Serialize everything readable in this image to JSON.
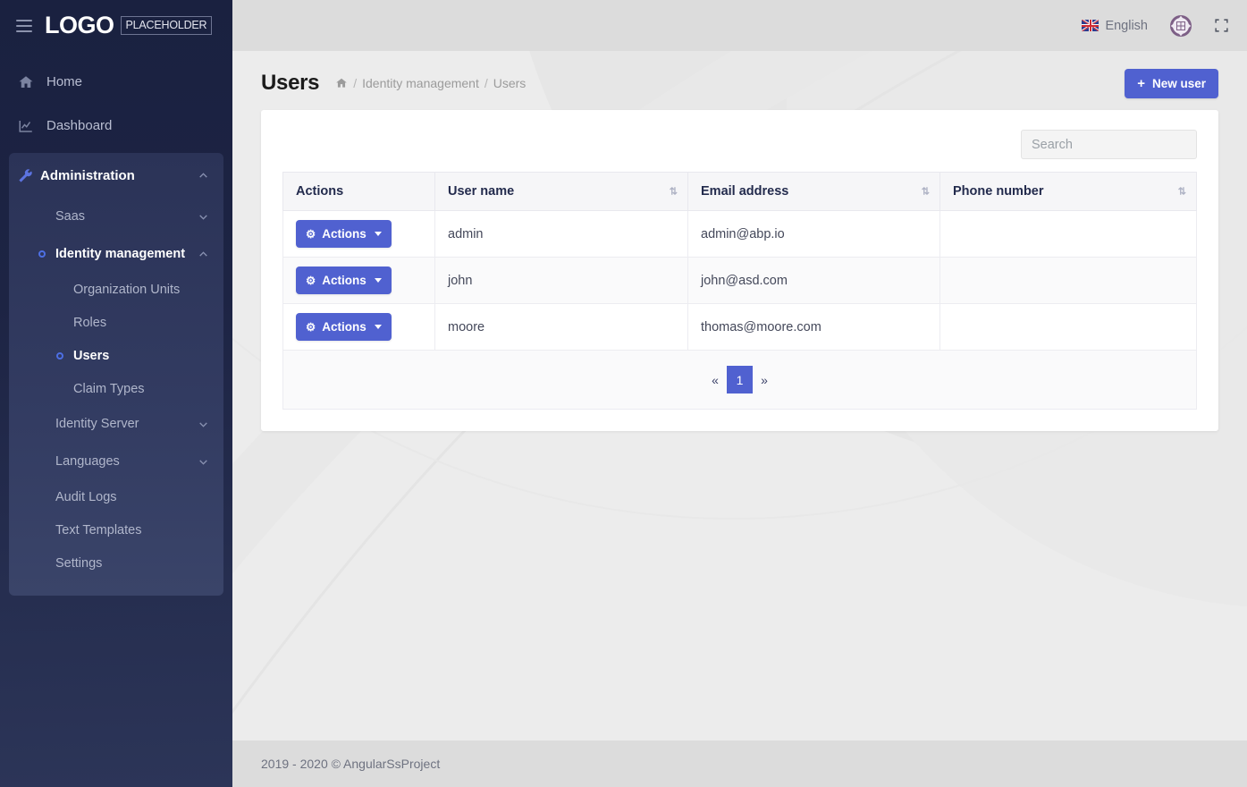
{
  "brand": {
    "menu_icon": "hamburger-icon",
    "logo_text": "LOGO",
    "logo_badge": "PLACEHOLDER"
  },
  "sidebar": {
    "items": [
      {
        "label": "Home",
        "icon": "home-icon"
      },
      {
        "label": "Dashboard",
        "icon": "chart-line-icon"
      }
    ],
    "administration": {
      "label": "Administration",
      "icon": "wrench-icon",
      "expanded": true,
      "chevron": "chevron-up-icon",
      "children": [
        {
          "label": "Saas",
          "type": "group",
          "expanded": false,
          "chevron": "chevron-down-icon"
        },
        {
          "label": "Identity management",
          "type": "group",
          "expanded": true,
          "active": true,
          "chevron": "chevron-up-icon"
        },
        {
          "label": "Organization Units",
          "type": "leaf"
        },
        {
          "label": "Roles",
          "type": "leaf"
        },
        {
          "label": "Users",
          "type": "leaf",
          "active": true
        },
        {
          "label": "Claim Types",
          "type": "leaf"
        },
        {
          "label": "Identity Server",
          "type": "group",
          "expanded": false,
          "chevron": "chevron-down-icon"
        },
        {
          "label": "Languages",
          "type": "group",
          "expanded": false,
          "chevron": "chevron-down-icon"
        },
        {
          "label": "Audit Logs",
          "type": "plain"
        },
        {
          "label": "Text Templates",
          "type": "plain"
        },
        {
          "label": "Settings",
          "type": "plain"
        }
      ]
    }
  },
  "topbar": {
    "language": "English",
    "language_flag": "uk-flag-icon",
    "avatar_icon": "user-avatar-icon",
    "fullscreen_icon": "fullscreen-icon"
  },
  "page": {
    "title": "Users",
    "breadcrumb": {
      "home_icon": "home-icon",
      "items": [
        "Identity management",
        "Users"
      ],
      "separator": "/"
    },
    "new_user_button": "New user",
    "new_user_plus": "+"
  },
  "search": {
    "value": "",
    "placeholder": "Search"
  },
  "table": {
    "columns": [
      {
        "label": "Actions",
        "sortable": false
      },
      {
        "label": "User name",
        "sortable": true,
        "sort_icon": "sort-icon"
      },
      {
        "label": "Email address",
        "sortable": true,
        "sort_icon": "sort-icon"
      },
      {
        "label": "Phone number",
        "sortable": true,
        "sort_icon": "sort-icon"
      }
    ],
    "action_label": "Actions",
    "action_icon": "gear-icon",
    "rows": [
      {
        "user_name": "admin",
        "email": "admin@abp.io",
        "phone": ""
      },
      {
        "user_name": "john",
        "email": "john@asd.com",
        "phone": ""
      },
      {
        "user_name": "moore",
        "email": "thomas@moore.com",
        "phone": ""
      }
    ]
  },
  "pagination": {
    "prev": "«",
    "next": "»",
    "current_page": "1"
  },
  "footer": {
    "text": "2019 - 2020 © AngularSsProject"
  },
  "colors": {
    "accent": "#5061d0",
    "sidebar": "#1b2240",
    "topbar": "#dcdcdc",
    "page_bg": "#ececec",
    "sidebar_active_dot": "#4d6fe3",
    "heading_text": "#232b4d"
  }
}
